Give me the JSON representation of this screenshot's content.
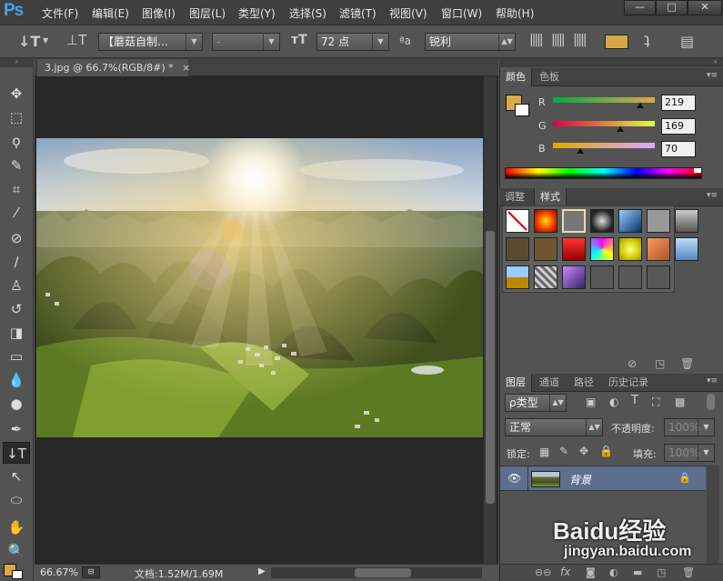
{
  "app": {
    "logo": "Ps"
  },
  "menu": [
    "文件(F)",
    "编辑(E)",
    "图像(I)",
    "图层(L)",
    "类型(Y)",
    "选择(S)",
    "滤镜(T)",
    "视图(V)",
    "窗口(W)",
    "帮助(H)"
  ],
  "window_buttons": [
    "—",
    "□",
    "✕"
  ],
  "options": {
    "font_family": "【蘑菇自制…",
    "font_style": "-",
    "font_size": "72 点",
    "aa_label": "ªa",
    "antialias": "锐利",
    "text_color": "#d8a848"
  },
  "document": {
    "tab": "3.jpg @ 66.7%(RGB/8#) *",
    "close": "×"
  },
  "status": {
    "zoom": "66.67%",
    "doc": "文档:1.52M/1.69M"
  },
  "color_panel": {
    "tabs": [
      "颜色",
      "色板"
    ],
    "fg": "#dba946",
    "bg": "#ffffff",
    "channels": [
      {
        "label": "R",
        "value": "219",
        "frac": 0.86
      },
      {
        "label": "G",
        "value": "169",
        "frac": 0.66
      },
      {
        "label": "B",
        "value": "70",
        "frac": 0.27
      }
    ]
  },
  "styles_panel": {
    "tabs": [
      "调整",
      "样式"
    ]
  },
  "layers_panel": {
    "tabs": [
      "图层",
      "通道",
      "路径",
      "历史记录"
    ],
    "filter_kind": "ρ类型",
    "blend_mode": "正常",
    "opacity_label": "不透明度:",
    "opacity_value": "100%",
    "lock_label": "锁定:",
    "fill_label": "填充:",
    "fill_value": "100%",
    "layer_name": "背景"
  },
  "watermark": {
    "text": "Baidu经验",
    "url": "jingyan.baidu.com"
  }
}
